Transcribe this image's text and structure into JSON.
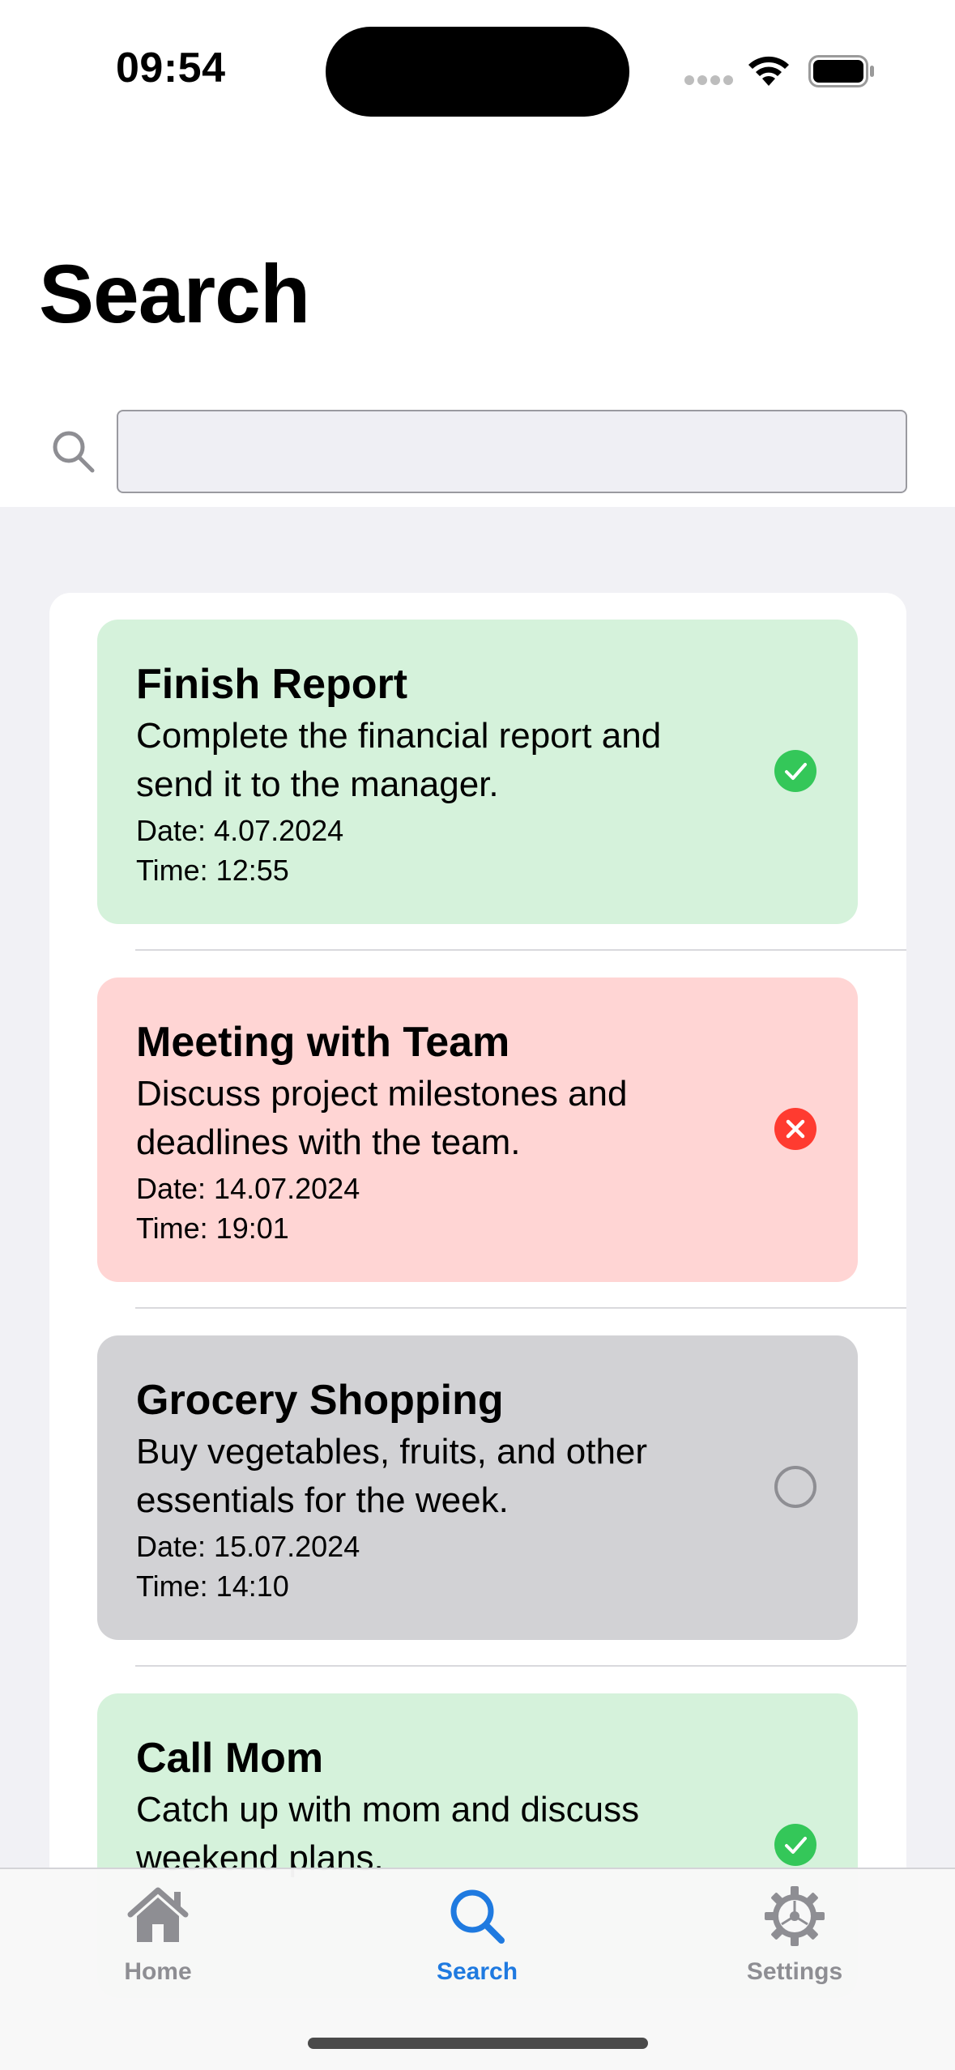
{
  "status_bar": {
    "time": "09:54"
  },
  "header": {
    "title": "Search"
  },
  "search": {
    "placeholder": "",
    "value": ""
  },
  "tasks": [
    {
      "title": "Finish Report",
      "description": "Complete the financial report and send it to the manager.",
      "date": "Date: 4.07.2024",
      "time": "Time: 12:55",
      "status": "completed",
      "color": "#d5f2db"
    },
    {
      "title": "Meeting with Team",
      "description": "Discuss project milestones and deadlines with the team.",
      "date": "Date: 14.07.2024",
      "time": "Time: 19:01",
      "status": "failed",
      "color": "#ffd5d4"
    },
    {
      "title": "Grocery Shopping",
      "description": "Buy vegetables, fruits, and other essentials for the week.",
      "date": "Date: 15.07.2024",
      "time": "Time: 14:10",
      "status": "pending",
      "color": "#d2d2d5"
    },
    {
      "title": "Call Mom",
      "description": "Catch up with mom and discuss weekend plans.",
      "status": "completed",
      "color": "#d5f2db"
    }
  ],
  "tab_bar": {
    "items": [
      {
        "label": "Home",
        "icon": "house-icon",
        "active": false
      },
      {
        "label": "Search",
        "icon": "magnifier-icon",
        "active": true
      },
      {
        "label": "Settings",
        "icon": "gear-icon",
        "active": false
      }
    ],
    "active_color": "#1f7ae0",
    "inactive_color": "#8e8e93"
  },
  "colors": {
    "success": "#34c759",
    "error": "#ff3b30",
    "accent": "#1f7ae0"
  }
}
